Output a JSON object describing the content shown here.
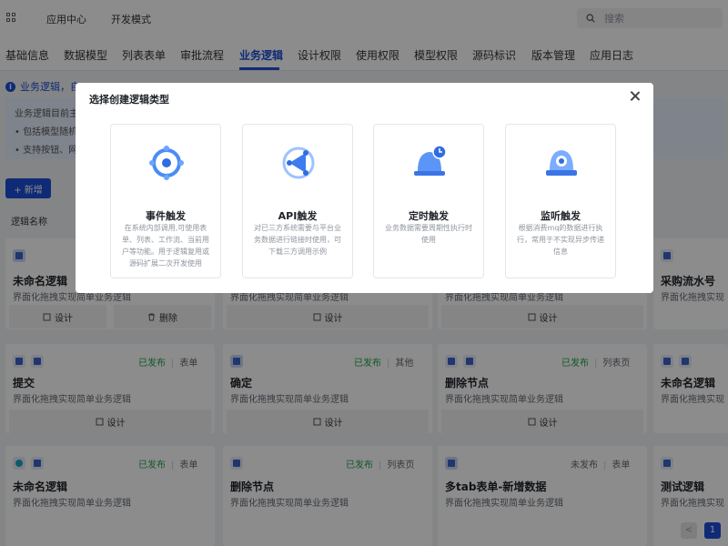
{
  "topbar": {
    "nav": [
      "应用中心",
      "开发模式"
    ],
    "search_placeholder": "搜索"
  },
  "tabs": [
    "基础信息",
    "数据模型",
    "列表表单",
    "审批流程",
    "业务逻辑",
    "设计权限",
    "使用权限",
    "模型权限",
    "源码标识",
    "版本管理",
    "应用日志"
  ],
  "active_tab": "业务逻辑",
  "info": {
    "heading": "业务逻辑，自",
    "lines": [
      "业务逻辑目前主",
      "• 包括模型随机",
      "• 支持按钮、网"
    ]
  },
  "add_button": "+ 新增",
  "filter_label": "逻辑名称",
  "actions": {
    "design": "设计",
    "delete": "删除"
  },
  "cards_row1": [
    {
      "title": "未命名逻辑",
      "desc": "界面化拖拽实现简单业务逻辑"
    },
    {
      "title": "",
      "desc": "界面化拖拽实现简单业务逻辑"
    },
    {
      "title": "",
      "desc": "界面化拖拽实现简单业务逻辑"
    },
    {
      "title": "采购流水号",
      "desc": "界面化拖拽实现"
    }
  ],
  "cards_row2": [
    {
      "title": "提交",
      "desc": "界面化拖拽实现简单业务逻辑",
      "status": "已发布",
      "type": "表单"
    },
    {
      "title": "确定",
      "desc": "界面化拖拽实现简单业务逻辑",
      "status": "已发布",
      "type": "其他"
    },
    {
      "title": "删除节点",
      "desc": "界面化拖拽实现简单业务逻辑",
      "status": "已发布",
      "type": "列表页"
    },
    {
      "title": "未命名逻辑",
      "desc": "界面化拖拽实现"
    }
  ],
  "cards_row3": [
    {
      "title": "未命名逻辑",
      "desc": "界面化拖拽实现简单业务逻辑",
      "status": "已发布",
      "type": "表单"
    },
    {
      "title": "删除节点",
      "desc": "界面化拖拽实现简单业务逻辑",
      "status": "已发布",
      "type": "列表页"
    },
    {
      "title": "多tab表单-新增数据",
      "desc": "界面化拖拽实现简单业务逻辑",
      "status": "未发布",
      "type": "表单"
    },
    {
      "title": "测试逻辑",
      "desc": "界面化拖拽实现"
    }
  ],
  "modal": {
    "title": "选择创建逻辑类型",
    "types": [
      {
        "name": "事件触发",
        "desc": "在系统内部调用,可使用表单、列表、工作流、当前用户等功能。用于逻辑复用或源码扩展二次开发使用",
        "icon": "event-trigger-icon"
      },
      {
        "name": "API触发",
        "desc": "对已三方系统需要与平台业务数据进行链接时使用，可下载三方调用示例",
        "icon": "api-trigger-icon"
      },
      {
        "name": "定时触发",
        "desc": "业务数据需要周期性执行时使用",
        "icon": "timer-trigger-icon"
      },
      {
        "name": "监听触发",
        "desc": "根据消费mq的数据进行执行，常用于不实现异步传递信息",
        "icon": "listen-trigger-icon"
      }
    ]
  },
  "pager": {
    "prev": "<",
    "current": "1"
  },
  "colors": {
    "primary": "#1d4ed8",
    "published": "#22a34b"
  }
}
